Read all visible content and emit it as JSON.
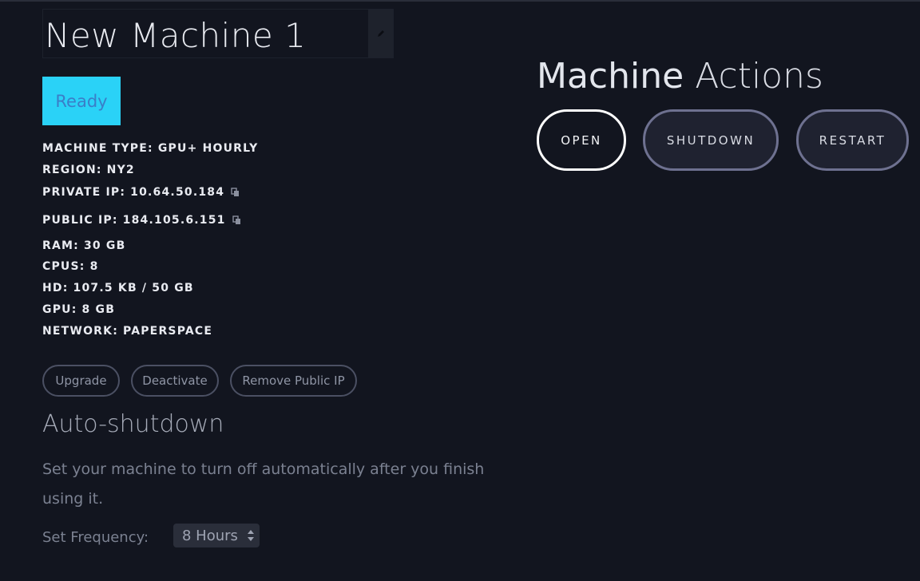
{
  "machine": {
    "name": "New Machine 1",
    "status": "Ready",
    "specs": [
      {
        "label": "MACHINE TYPE:",
        "value": "GPU+ HOURLY",
        "copyable": false
      },
      {
        "label": "REGION:",
        "value": "NY2",
        "copyable": false
      },
      {
        "label": "PRIVATE IP:",
        "value": "10.64.50.184",
        "copyable": true
      },
      {
        "label": "PUBLIC IP:",
        "value": "184.105.6.151",
        "copyable": true
      },
      {
        "label": "RAM:",
        "value": "30 GB",
        "copyable": false
      },
      {
        "label": "CPUS:",
        "value": "8",
        "copyable": false
      },
      {
        "label": "HD:",
        "value": "107.5 KB / 50 GB",
        "copyable": false
      },
      {
        "label": "GPU:",
        "value": "8 GB",
        "copyable": false
      },
      {
        "label": "NETWORK:",
        "value": "PAPERSPACE",
        "copyable": false
      }
    ]
  },
  "manage_buttons": {
    "upgrade": "Upgrade",
    "deactivate": "Deactivate",
    "remove_public_ip": "Remove Public IP"
  },
  "auto_shutdown": {
    "title": "Auto-shutdown",
    "description": "Set your machine to turn off automatically after you finish using it.",
    "frequency_label": "Set Frequency:",
    "frequency_value": "8 Hours"
  },
  "actions": {
    "title_strong": "Machine",
    "title_light": "Actions",
    "open": "OPEN",
    "shutdown": "SHUTDOWN",
    "restart": "RESTART"
  },
  "colors": {
    "background": "#12151f",
    "status_ready": "#2ad2f7",
    "button_border": "#6e7190"
  },
  "icons": {
    "edit": "pencil-icon",
    "copy": "copy-icon",
    "select": "select-arrows-icon"
  }
}
